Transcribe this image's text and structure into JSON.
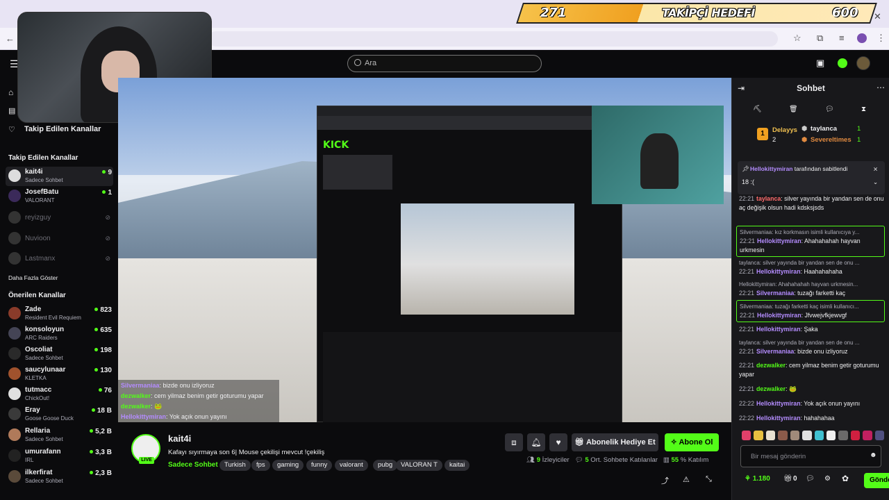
{
  "goal": {
    "current": "271",
    "title": "TAKİPÇİ HEDEFİ",
    "target": "600"
  },
  "search": {
    "placeholder": "Ara"
  },
  "sidebar": {
    "followed_header_top": "Takip Edilen Kanallar",
    "followed_header": "Takip Edilen Kanallar",
    "followed": [
      {
        "name": "kait4i",
        "sub": "Sadece Sohbet",
        "count": "9"
      },
      {
        "name": "JosefBatu",
        "sub": "VALORANT",
        "count": "1"
      },
      {
        "name": "reyizguy",
        "sub": "",
        "count": ""
      },
      {
        "name": "Nuvioon",
        "sub": "",
        "count": ""
      },
      {
        "name": "Lastmanx",
        "sub": "",
        "count": ""
      }
    ],
    "show_more": "Daha Fazla Göster",
    "recommended_header": "Önerilen Kanallar",
    "recommended": [
      {
        "name": "Zade",
        "sub": "Resident Evil Requiem",
        "count": "823"
      },
      {
        "name": "konsoloyun",
        "sub": "ARC Raiders",
        "count": "635"
      },
      {
        "name": "Oscoliat",
        "sub": "Sadece Sohbet",
        "count": "198"
      },
      {
        "name": "saucylunaar",
        "sub": "KLETKA",
        "count": "130"
      },
      {
        "name": "tutmacc",
        "sub": "ChickOut!",
        "count": "76"
      },
      {
        "name": "Eray",
        "sub": "Goose Goose Duck",
        "count": "18 B"
      },
      {
        "name": "Rellaria",
        "sub": "Sadece Sohbet",
        "count": "5,2 B"
      },
      {
        "name": "umurafann",
        "sub": "IRL",
        "count": "3,3 B"
      },
      {
        "name": "ilkerfirat",
        "sub": "Sadece Sohbet",
        "count": "2,3 B"
      }
    ]
  },
  "video_overlay_chat": [
    {
      "user": "Silvermaniaa",
      "text": ": bizde onu izliyoruz",
      "color": "#b48cff"
    },
    {
      "user": "dezwalker",
      "text": ": cem yilmaz benim getir goturumu yapar",
      "color": "#53fc18"
    },
    {
      "user": "dezwalker",
      "text": ": 🐸",
      "color": "#53fc18"
    },
    {
      "user": "Hellokittymiran",
      "text": ": Yok açık onun yayını",
      "color": "#b48cff"
    }
  ],
  "stream": {
    "name": "kait4i",
    "live": "LIVE",
    "title": "Kafayı sıyırmaya son 6| Mouse çekilişi mevcut !çekiliş",
    "category": "Sadece Sohbet",
    "tags": [
      "Turkish",
      "fps",
      "gaming",
      "funny",
      "valorant",
      "pubg",
      "VALORAN T",
      "kaitai"
    ],
    "gift_label": "Abonelik Hediye Et",
    "subscribe_label": "Abone Ol",
    "viewers": "9",
    "viewers_label": "İzleyiciler",
    "avg_chat": "5",
    "avg_chat_label": "Ort. Sohbete Katılanlar",
    "participation": "55",
    "participation_label": "% Katılım"
  },
  "chat": {
    "title": "Sohbet",
    "leaderboard": {
      "first": {
        "name": "Delayys",
        "count": "2",
        "rank": "1"
      },
      "second": {
        "name": "taylanca",
        "count": "1"
      },
      "third": {
        "name": "Severeltimes",
        "count": "1"
      }
    },
    "pinned": {
      "by": "Hellokittymiran",
      "by_suffix": " tarafından sabitlendi",
      "text": "18 :("
    },
    "messages": [
      {
        "time": "22:21",
        "user": "taylanca",
        "color": "#ff6b6b",
        "text": ": silver yayında bir yandan sen de onu aç değişik olsun hadi kdsksjsds",
        "reply": ""
      },
      {
        "time": "22:21",
        "user": "Hellokittymiran",
        "color": "#b48cff",
        "text": ": Ahahahahah hayvan urkmesin",
        "reply": "Silvermaniaa: kız korkmasın isimli kullanıcıya y..."
      },
      {
        "time": "22:21",
        "user": "Hellokittymiran",
        "color": "#b48cff",
        "text": ": Haahahahaha",
        "reply": "taylanca: silver yayında bir yandan sen de onu ..."
      },
      {
        "time": "22:21",
        "user": "Silvermaniaa",
        "color": "#b48cff",
        "text": ": tuzağı farketti kaç",
        "reply": "Hellokittymiran: Ahahahahah hayvan urkmesin..."
      },
      {
        "time": "22:21",
        "user": "Hellokittymiran",
        "color": "#b48cff",
        "text": ": Jfvwejvfkjewvgf",
        "reply": "Silvermaniaa: tuzağı farketti kaç isimli kullanıcı..."
      },
      {
        "time": "22:21",
        "user": "Hellokittymiran",
        "color": "#b48cff",
        "text": ": Şaka",
        "reply": ""
      },
      {
        "time": "22:21",
        "user": "Silvermaniaa",
        "color": "#b48cff",
        "text": ": bizde onu izliyoruz",
        "reply": "taylanca: silver yayında bir yandan sen de onu ..."
      },
      {
        "time": "22:21",
        "user": "dezwalker",
        "color": "#53fc18",
        "text": ": cem yilmaz benim getir goturumu yapar",
        "reply": ""
      },
      {
        "time": "22:21",
        "user": "dezwalker",
        "color": "#53fc18",
        "text": ": 🐸",
        "reply": ""
      },
      {
        "time": "22:22",
        "user": "Hellokittymiran",
        "color": "#b48cff",
        "text": ": Yok açık onun yayını",
        "reply": ""
      },
      {
        "time": "22:22",
        "user": "Hellokittymiran",
        "color": "#b48cff",
        "text": ": hahahahaa",
        "reply": ""
      }
    ],
    "input_placeholder": "Bir mesaj gönderin",
    "points": "1.180",
    "gift_count": "0",
    "send_label": "Gönder"
  },
  "colors": {
    "accent": "#53fc18",
    "bg": "#0b0b0d",
    "chat_bg": "#18181b"
  }
}
